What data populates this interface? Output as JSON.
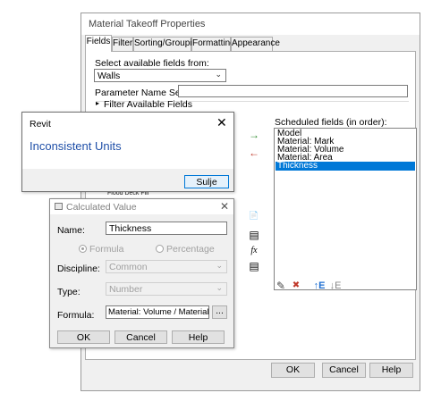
{
  "main_dialog": {
    "title": "Material Takeoff Properties",
    "tabs": [
      "Fields",
      "Filter",
      "Sorting/Grouping",
      "Formatting",
      "Appearance"
    ],
    "available_fields_label": "Select available fields from:",
    "available_fields_value": "Walls",
    "param_search_label": "Parameter Name Search:",
    "param_search_value": "",
    "filter_label": "Filter Available Fields",
    "partial_field_text": "Flood Deck Fill",
    "scheduled_label": "Scheduled fields (in order):",
    "scheduled_fields": [
      "Model",
      "Material: Mark",
      "Material: Volume",
      "Material: Area",
      "Thickness"
    ],
    "selected_field": "Thickness",
    "ok": "OK",
    "cancel": "Cancel",
    "help": "Help"
  },
  "revit_box": {
    "title": "Revit",
    "close": "✕",
    "message": "Inconsistent Units",
    "button": "Sulje"
  },
  "calc_dialog": {
    "title": "Calculated Value",
    "close": "✕",
    "name_label": "Name:",
    "name_value": "Thickness",
    "formula_radio": "Formula",
    "percentage_radio": "Percentage",
    "discipline_label": "Discipline:",
    "discipline_value": "Common",
    "type_label": "Type:",
    "type_value": "Number",
    "formula_label": "Formula:",
    "formula_value": "Material: Volume / Material: Area",
    "browse": "...",
    "ok": "OK",
    "cancel": "Cancel",
    "help": "Help"
  },
  "icons": {
    "add_field": "→",
    "remove_field": "←",
    "add_parameter": "📄",
    "combine_params": "▤",
    "calc_value": "fx",
    "edit": "✎",
    "delete": "✖",
    "move_up": "↑E",
    "move_down": "↓E"
  }
}
